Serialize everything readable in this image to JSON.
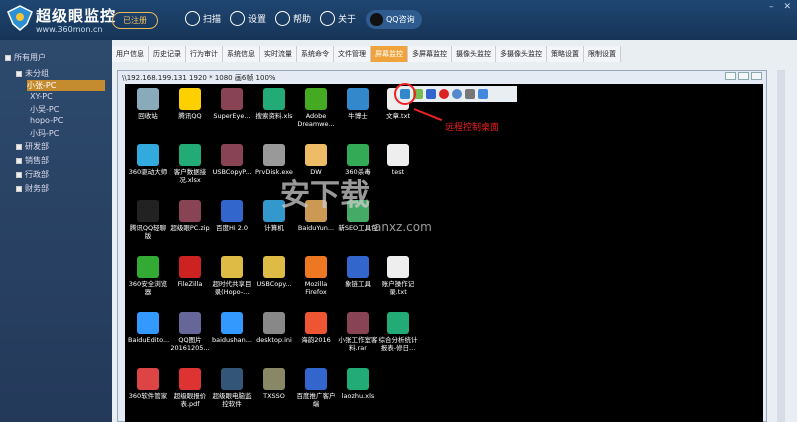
{
  "app": {
    "brand": "超级眼监控",
    "url": "www.360mon.cn",
    "register": "已注册"
  },
  "nav": [
    {
      "label": "扫描"
    },
    {
      "label": "设置"
    },
    {
      "label": "帮助"
    },
    {
      "label": "关于"
    }
  ],
  "qq": "QQ咨询",
  "window_controls": [
    "–",
    "✕"
  ],
  "tree": {
    "root": "所有用户",
    "groups": [
      {
        "label": "未分组",
        "items": [
          "小张-PC",
          "XY-PC",
          "小吴-PC",
          "hopo-PC",
          "小玛-PC"
        ]
      },
      {
        "label": "研发部"
      },
      {
        "label": "销售部"
      },
      {
        "label": "行政部"
      },
      {
        "label": "财务部"
      }
    ]
  },
  "tabs": [
    "用户信息",
    "历史记录",
    "行为审计",
    "系统信息",
    "实时流量",
    "系统命令",
    "文件管理",
    "屏幕监控",
    "多屏幕监控",
    "摄像头监控",
    "多摄像头监控",
    "策略设置",
    "限制设置"
  ],
  "remote": {
    "title": "\\\\192.168.199.131 1920 * 1080 画6帧 100%"
  },
  "annotation": "远程控制桌面",
  "watermark": {
    "main": "安下载",
    "sub": "anxz.com"
  },
  "desktop_icons": [
    {
      "label": "回收站",
      "c": "#8ab"
    },
    {
      "label": "腾讯QQ",
      "c": "#ffd000"
    },
    {
      "label": "SuperEye...",
      "c": "#845"
    },
    {
      "label": "搜索资料.xls",
      "c": "#2a7"
    },
    {
      "label": "Adobe Dreamwe...",
      "c": "#4a2"
    },
    {
      "label": "牛博士",
      "c": "#38c"
    },
    {
      "label": "文章.txt",
      "c": "#eee"
    },
    {
      "label": "360驱动大师",
      "c": "#3ad"
    },
    {
      "label": "客户数据接况.xlsx",
      "c": "#2a7"
    },
    {
      "label": "USBCopyP...",
      "c": "#845"
    },
    {
      "label": "PrvDisk.exe",
      "c": "#999"
    },
    {
      "label": "DW",
      "c": "#eb6"
    },
    {
      "label": "360杀毒",
      "c": "#3a5"
    },
    {
      "label": "test",
      "c": "#eee"
    },
    {
      "label": "腾讯QQ轻聊版",
      "c": "#222"
    },
    {
      "label": "超级眼PC.zip",
      "c": "#845"
    },
    {
      "label": "百度Hi 2.0",
      "c": "#36c"
    },
    {
      "label": "计算机",
      "c": "#39c"
    },
    {
      "label": "BaiduYun...",
      "c": "#c95"
    },
    {
      "label": "新SEO工具包",
      "c": "#4a6"
    },
    {
      "label": "",
      "c": "#000"
    },
    {
      "label": "360安全浏览器",
      "c": "#3a3"
    },
    {
      "label": "FileZilla",
      "c": "#c22"
    },
    {
      "label": "超时代共享目录(Hopo-...",
      "c": "#db4"
    },
    {
      "label": "USBCopy...",
      "c": "#db4"
    },
    {
      "label": "Mozilla Firefox",
      "c": "#e72"
    },
    {
      "label": "象链工具",
      "c": "#36c"
    },
    {
      "label": "账户操作记录.txt",
      "c": "#eee"
    },
    {
      "label": "BaiduEdito...",
      "c": "#39f"
    },
    {
      "label": "QQ图片 20161205...",
      "c": "#669"
    },
    {
      "label": "baidushan...",
      "c": "#39f"
    },
    {
      "label": "desktop.ini",
      "c": "#888"
    },
    {
      "label": "海韵2016",
      "c": "#e53"
    },
    {
      "label": "小张工作室客料.rar",
      "c": "#845"
    },
    {
      "label": "综合分析统计报表-修日...",
      "c": "#2a7"
    },
    {
      "label": "360软件管家",
      "c": "#d44"
    },
    {
      "label": "超级眼报价表.pdf",
      "c": "#d33"
    },
    {
      "label": "超级眼电脑监控软件",
      "c": "#357"
    },
    {
      "label": "TXSSO",
      "c": "#886"
    },
    {
      "label": "百度推广客户端",
      "c": "#36c"
    },
    {
      "label": "laozhu.xls",
      "c": "#2a7"
    }
  ]
}
